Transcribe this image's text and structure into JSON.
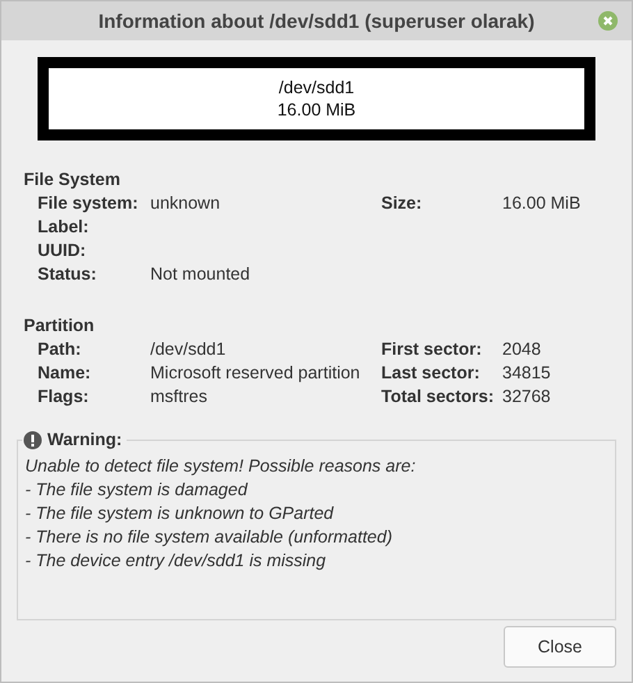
{
  "window": {
    "title": "Information about /dev/sdd1 (superuser olarak)"
  },
  "partition_graphic": {
    "path": "/dev/sdd1",
    "size": "16.00 MiB"
  },
  "sections": [
    {
      "heading": "File System",
      "rows": [
        {
          "label": "File system:",
          "value": "unknown",
          "label_2": "Size:",
          "value_2": "16.00 MiB"
        },
        {
          "label": "Label:"
        },
        {
          "label": "UUID:"
        },
        {
          "label": "Status:",
          "value": "Not mounted"
        }
      ]
    },
    {
      "heading": "Partition",
      "rows": [
        {
          "label": "Path:",
          "value": "/dev/sdd1",
          "label_2": "First sector:",
          "value_2": "2048"
        },
        {
          "label": "Name:",
          "value": "Microsoft reserved partition",
          "label_2": "Last sector:",
          "value_2": "34815"
        },
        {
          "label": "Flags:",
          "value": "msftres",
          "label_2": "Total sectors:",
          "value_2": "32768"
        }
      ]
    }
  ],
  "warning": {
    "title": "Warning:",
    "lines": [
      "Unable to detect file system! Possible reasons are:",
      "- The file system is damaged",
      "- The file system is unknown to GParted",
      "- There is no file system available (unformatted)",
      "- The device entry /dev/sdd1 is missing"
    ]
  },
  "buttons": [
    "Close"
  ]
}
